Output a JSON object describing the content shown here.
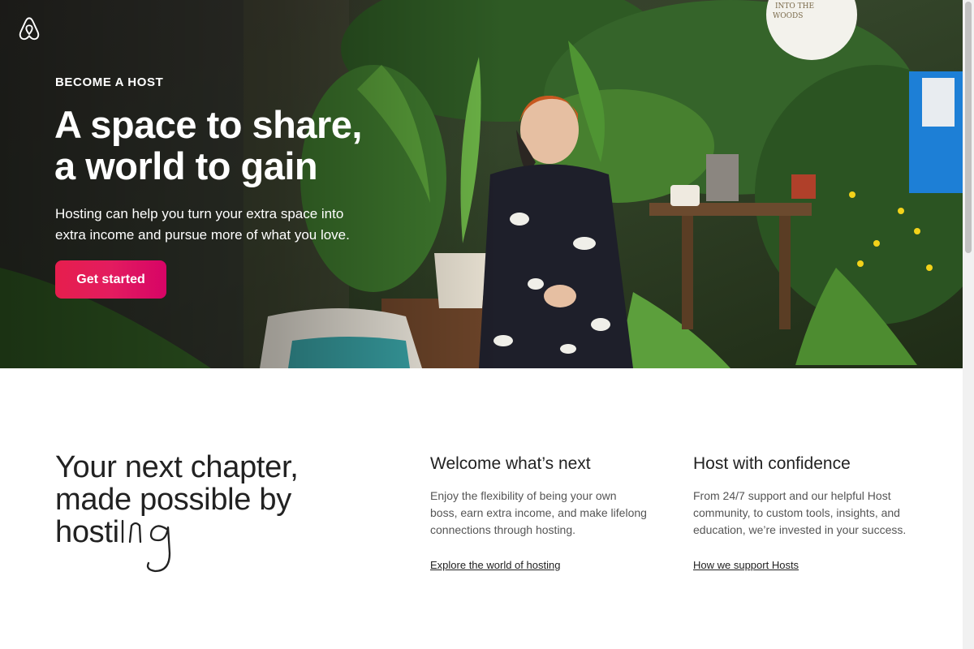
{
  "hero": {
    "eyebrow": "BECOME A HOST",
    "title_lines": [
      "A space to share,",
      "a world to gain"
    ],
    "subtitle_lines": [
      "Hosting can help you turn your extra space into",
      "extra income and pursue more of what you love."
    ],
    "cta_label": "Get started",
    "sign_text": [
      "INTO THE",
      "WOODS"
    ]
  },
  "intro": {
    "title_lines": [
      "Your next chapter,",
      "made possible by",
      "hosti"
    ],
    "script_suffix": "ng"
  },
  "columns": [
    {
      "heading": "Welcome what’s next",
      "body_lines": [
        "Enjoy the flexibility of being your own",
        "boss, earn extra income, and make lifelong",
        "connections through hosting."
      ],
      "link": "Explore the world of hosting"
    },
    {
      "heading": "Host with confidence",
      "body_lines": [
        "From 24/7 support and our helpful Host",
        "community, to custom tools, insights, and",
        "education, we’re invested in your success."
      ],
      "link": "How we support Hosts"
    }
  ],
  "colors": {
    "brand": "#ff385c",
    "cta_gradient": [
      "#e61e4d",
      "#d70466"
    ],
    "text_primary": "#222222",
    "text_secondary": "#555555"
  },
  "icons": {
    "logo": "airbnb-belo-logo"
  }
}
